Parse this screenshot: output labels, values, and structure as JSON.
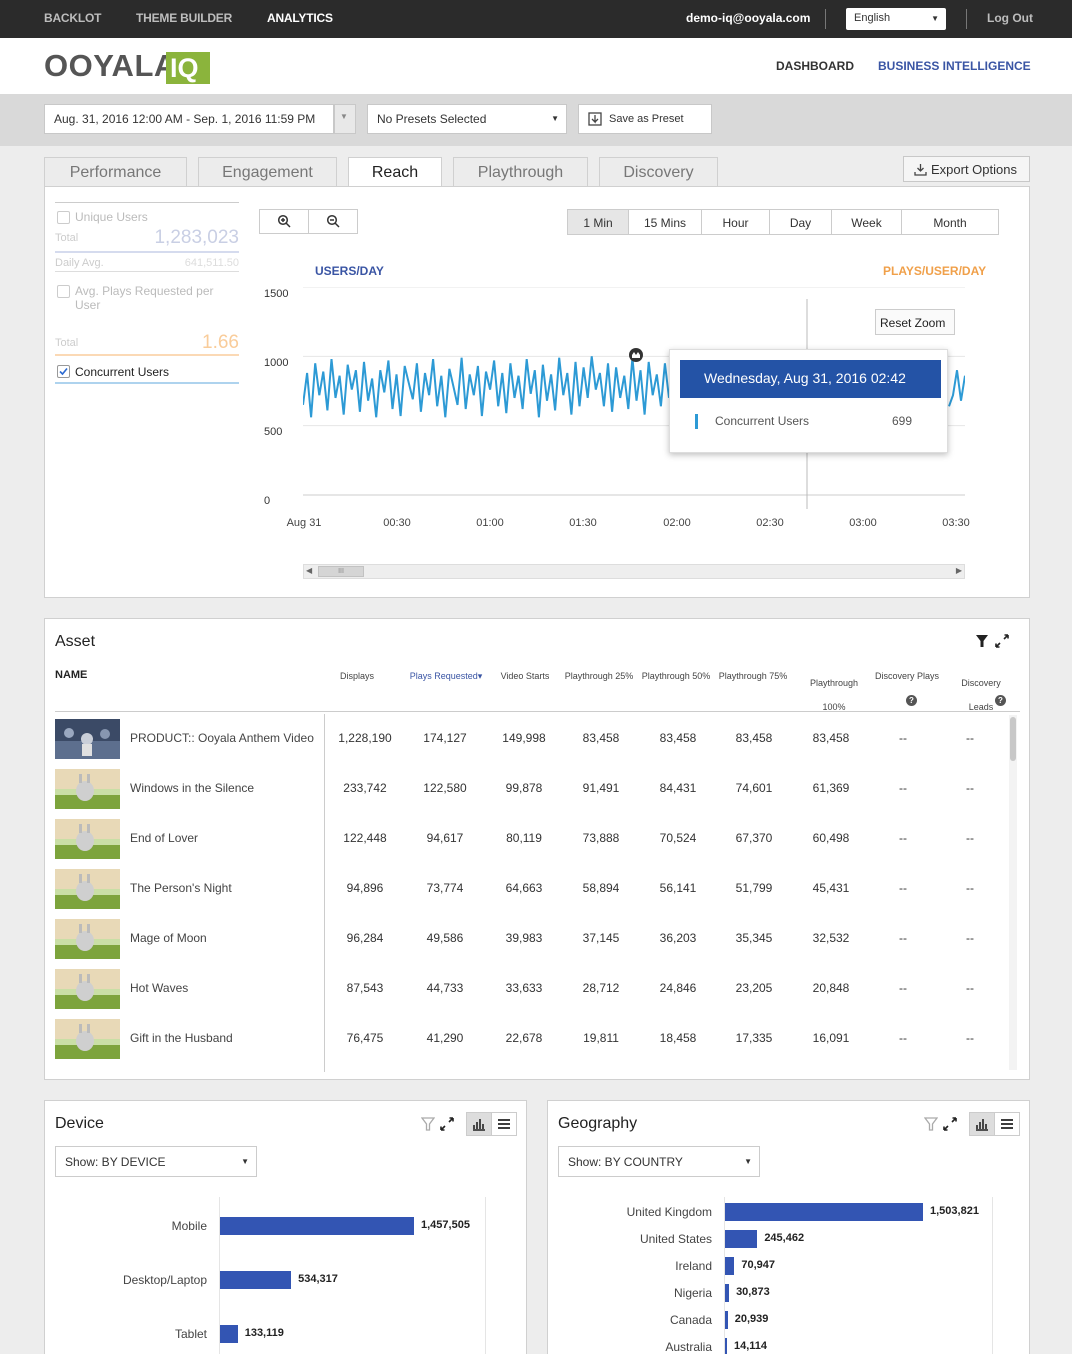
{
  "topbar": {
    "nav": [
      "BACKLOT",
      "THEME BUILDER",
      "ANALYTICS"
    ],
    "email": "demo-iq@ooyala.com",
    "language": "English",
    "logout": "Log Out"
  },
  "header": {
    "logo_text": "OOYALA",
    "logo_badge": "IQ",
    "links": [
      "DASHBOARD",
      "BUSINESS INTELLIGENCE"
    ]
  },
  "filters": {
    "date_range": "Aug. 31, 2016 12:00 AM - Sep. 1, 2016 11:59 PM",
    "presets": "No Presets Selected",
    "save_preset": "Save as Preset"
  },
  "tabs": [
    "Performance",
    "Engagement",
    "Reach",
    "Playthrough",
    "Discovery"
  ],
  "active_tab": "Reach",
  "export_label": "Export Options",
  "metrics": {
    "unique_users": {
      "label": "Unique Users",
      "total_label": "Total",
      "total": "1,283,023",
      "avg_label": "Daily Avg.",
      "avg": "641,511.50"
    },
    "avg_plays": {
      "label": "Avg. Plays Requested per User",
      "total_label": "Total",
      "total": "1.66"
    },
    "concurrent": {
      "label": "Concurrent Users",
      "checked": true
    }
  },
  "granularity": [
    "1 Min",
    "15 Mins",
    "Hour",
    "Day",
    "Week",
    "Month"
  ],
  "active_granularity": "1 Min",
  "colors": {
    "accent": "#3a55a4",
    "series": "#2d9ad5",
    "secondary": "#f0a04a",
    "bar": "#3355b3",
    "tooltip": "#2453a6",
    "logo": "#8bb43c"
  },
  "chart_data": {
    "type": "line",
    "left_axis_title": "USERS/DAY",
    "right_axis_title": "PLAYS/USER/DAY",
    "y_ticks": [
      "1500",
      "1000",
      "500",
      "0"
    ],
    "x_ticks": [
      "Aug 31",
      "00:30",
      "01:00",
      "01:30",
      "02:00",
      "02:30",
      "03:00",
      "03:30"
    ],
    "ylim": [
      0,
      1500
    ],
    "series": [
      {
        "name": "Concurrent Users",
        "values": [
          650,
          880,
          560,
          950,
          720,
          890,
          610,
          980,
          700,
          860,
          580,
          940,
          760,
          900,
          600,
          960,
          680,
          840,
          560,
          900,
          740,
          970,
          620,
          870,
          570,
          930,
          810,
          690,
          950,
          600,
          880,
          720,
          980,
          640,
          860,
          560,
          910,
          780,
          650,
          990,
          620,
          870,
          720,
          930,
          570,
          890,
          760,
          970,
          640,
          880,
          590,
          950,
          700,
          860,
          620,
          980,
          730,
          900,
          560,
          940,
          680,
          870,
          610,
          990,
          720,
          880,
          580,
          960,
          640,
          920,
          700,
          1000,
          760,
          880,
          640,
          950,
          600,
          920,
          700,
          860,
          620,
          990,
          680,
          900,
          580,
          960,
          720,
          870,
          640,
          950,
          700
        ]
      },
      {
        "name": "Concurrent Users",
        "values": [
          640,
          720,
          900,
          680,
          860
        ]
      }
    ],
    "tooltip": {
      "title": "Wednesday, Aug 31, 2016 02:42",
      "series": "Concurrent Users",
      "value": "699"
    },
    "reset_zoom": "Reset Zoom"
  },
  "asset": {
    "title": "Asset",
    "name_header": "NAME",
    "columns": [
      "Displays",
      "Plays Requested",
      "Video Starts",
      "Playthrough 25%",
      "Playthrough 50%",
      "Playthrough 75%",
      "Playthrough 100%",
      "Discovery Plays",
      "Discovery Leads"
    ],
    "rows": [
      {
        "name": "PRODUCT:: Ooyala Anthem Video",
        "values": [
          "1,228,190",
          "174,127",
          "149,998",
          "83,458",
          "83,458",
          "83,458",
          "83,458",
          "--",
          "--"
        ]
      },
      {
        "name": "Windows in the Silence",
        "values": [
          "233,742",
          "122,580",
          "99,878",
          "91,491",
          "84,431",
          "74,601",
          "61,369",
          "--",
          "--"
        ]
      },
      {
        "name": "End of Lover",
        "values": [
          "122,448",
          "94,617",
          "80,119",
          "73,888",
          "70,524",
          "67,370",
          "60,498",
          "--",
          "--"
        ]
      },
      {
        "name": "The Person's Night",
        "values": [
          "94,896",
          "73,774",
          "64,663",
          "58,894",
          "56,141",
          "51,799",
          "45,431",
          "--",
          "--"
        ]
      },
      {
        "name": "Mage of Moon",
        "values": [
          "96,284",
          "49,586",
          "39,983",
          "37,145",
          "36,203",
          "35,345",
          "32,532",
          "--",
          "--"
        ]
      },
      {
        "name": "Hot Waves",
        "values": [
          "87,543",
          "44,733",
          "33,633",
          "28,712",
          "24,846",
          "23,205",
          "20,848",
          "--",
          "--"
        ]
      },
      {
        "name": "Gift in the Husband",
        "values": [
          "76,475",
          "41,290",
          "22,678",
          "19,811",
          "18,458",
          "17,335",
          "16,091",
          "--",
          "--"
        ]
      }
    ]
  },
  "device": {
    "title": "Device",
    "show": "Show: BY DEVICE",
    "bars": [
      {
        "label": "Mobile",
        "value": 1457505,
        "display": "1,457,505"
      },
      {
        "label": "Desktop/Laptop",
        "value": 534317,
        "display": "534,317"
      },
      {
        "label": "Tablet",
        "value": 133119,
        "display": "133,119"
      }
    ]
  },
  "geography": {
    "title": "Geography",
    "show": "Show: BY COUNTRY",
    "bars": [
      {
        "label": "United Kingdom",
        "value": 1503821,
        "display": "1,503,821"
      },
      {
        "label": "United States",
        "value": 245462,
        "display": "245,462"
      },
      {
        "label": "Ireland",
        "value": 70947,
        "display": "70,947"
      },
      {
        "label": "Nigeria",
        "value": 30873,
        "display": "30,873"
      },
      {
        "label": "Canada",
        "value": 20939,
        "display": "20,939"
      },
      {
        "label": "Australia",
        "value": 14114,
        "display": "14,114"
      }
    ]
  }
}
